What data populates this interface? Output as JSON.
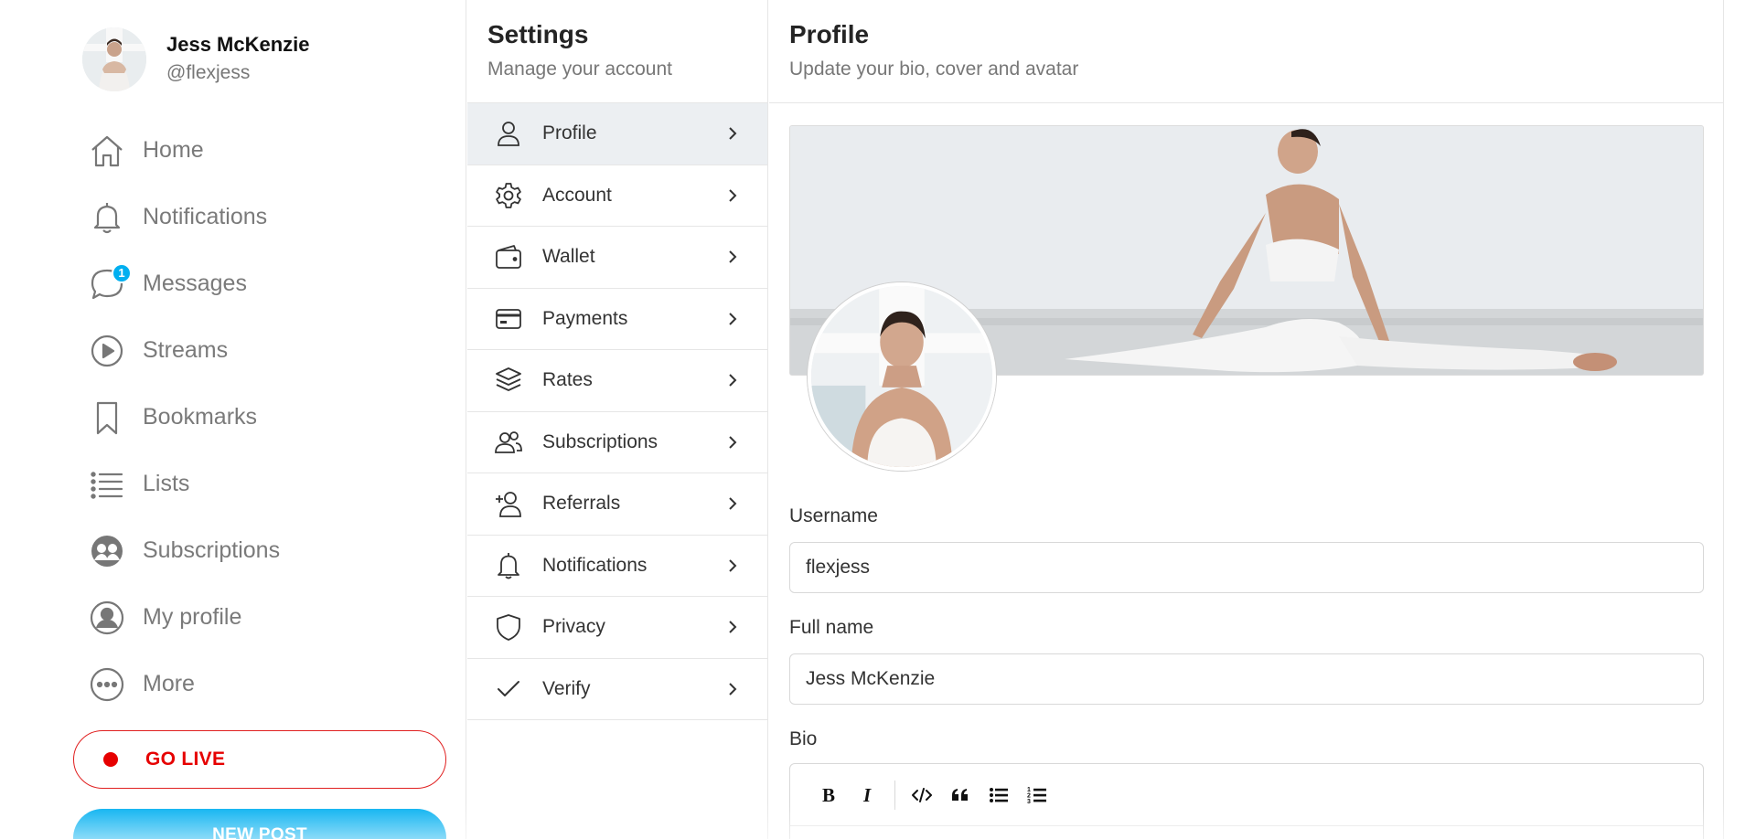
{
  "user": {
    "name": "Jess McKenzie",
    "handle": "@flexjess"
  },
  "nav": {
    "items": [
      {
        "label": "Home",
        "icon": "home-icon"
      },
      {
        "label": "Notifications",
        "icon": "bell-icon"
      },
      {
        "label": "Messages",
        "icon": "chat-bubble-icon",
        "badge": "1"
      },
      {
        "label": "Streams",
        "icon": "play-circle-icon"
      },
      {
        "label": "Bookmarks",
        "icon": "bookmark-icon"
      },
      {
        "label": "Lists",
        "icon": "list-icon"
      },
      {
        "label": "Subscriptions",
        "icon": "users-circle-icon"
      },
      {
        "label": "My profile",
        "icon": "user-circle-icon"
      },
      {
        "label": "More",
        "icon": "more-dots-icon"
      }
    ],
    "go_live": "GO LIVE",
    "new_post": "NEW POST"
  },
  "settings": {
    "title": "Settings",
    "subtitle": "Manage your account",
    "active": "Profile",
    "items": [
      {
        "label": "Profile",
        "icon": "user-icon"
      },
      {
        "label": "Account",
        "icon": "gear-icon"
      },
      {
        "label": "Wallet",
        "icon": "wallet-icon"
      },
      {
        "label": "Payments",
        "icon": "credit-card-icon"
      },
      {
        "label": "Rates",
        "icon": "layers-icon"
      },
      {
        "label": "Subscriptions",
        "icon": "users-icon"
      },
      {
        "label": "Referrals",
        "icon": "user-plus-icon"
      },
      {
        "label": "Notifications",
        "icon": "bell-icon"
      },
      {
        "label": "Privacy",
        "icon": "shield-icon"
      },
      {
        "label": "Verify",
        "icon": "checkmark-icon"
      }
    ]
  },
  "profile": {
    "title": "Profile",
    "subtitle": "Update your bio, cover and avatar",
    "username_label": "Username",
    "username_value": "flexjess",
    "fullname_label": "Full name",
    "fullname_value": "Jess McKenzie",
    "bio_label": "Bio",
    "bio_toolbar": [
      "bold-icon",
      "italic-icon",
      "code-icon",
      "quote-icon",
      "bullet-list-icon",
      "numbered-list-icon"
    ]
  },
  "colors": {
    "accent": "#00aff0",
    "live": "#e60000",
    "active_menu_bg": "#eceff2"
  }
}
